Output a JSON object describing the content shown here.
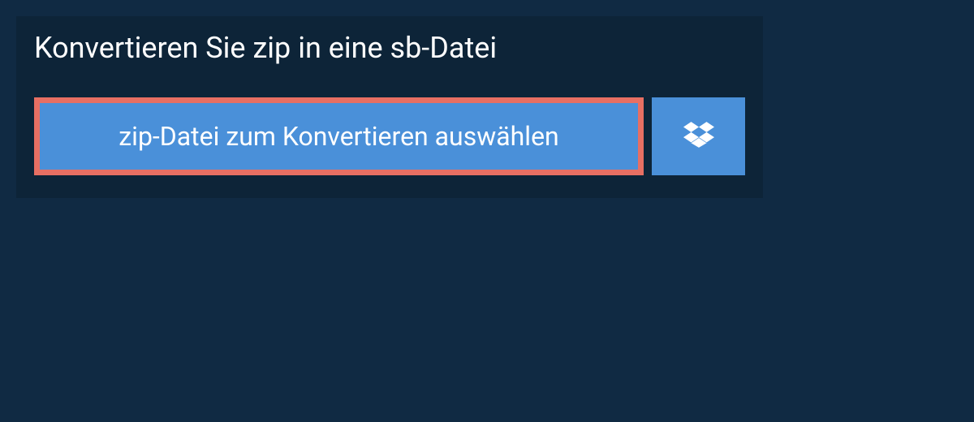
{
  "heading": "Konvertieren Sie zip in eine sb-Datei",
  "select_button_label": "zip-Datei zum Konvertieren auswählen"
}
